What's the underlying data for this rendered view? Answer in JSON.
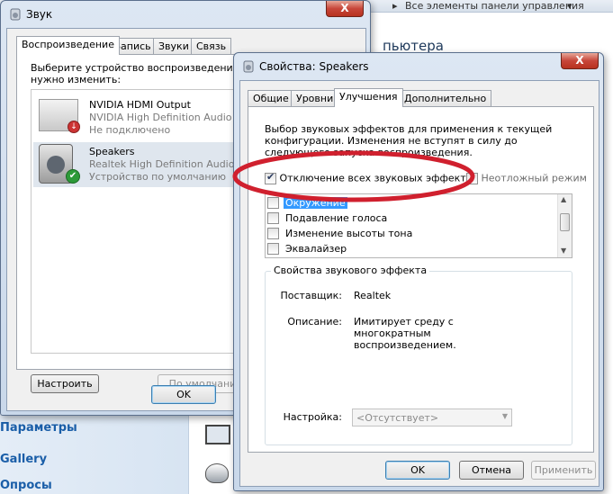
{
  "background": {
    "breadcrumb": "Все элементы панели управления",
    "heading": "пьютера",
    "sidebar_links": [
      "Параметры",
      "Gallery",
      "Опросы"
    ]
  },
  "sound_dialog": {
    "title": "Звук",
    "tabs": [
      "Воспроизведение",
      "Запись",
      "Звуки",
      "Связь"
    ],
    "instruction": "Выберите устройство воспроизведения, п",
    "instruction2": "нужно изменить:",
    "devices": [
      {
        "name": "NVIDIA HDMI Output",
        "driver": "NVIDIA High Definition Audio",
        "status": "Не подключено"
      },
      {
        "name": "Speakers",
        "driver": "Realtek High Definition Audio",
        "status": "Устройство по умолчанию"
      }
    ],
    "configure_label": "Настроить",
    "default_label": "По умолчани",
    "ok_label": "OK",
    "close_label": "X"
  },
  "props_dialog": {
    "title": "Свойства: Speakers",
    "close_label": "X",
    "tabs": [
      "Общие",
      "Уровни",
      "Улучшения",
      "Дополнительно"
    ],
    "description": "Выбор звуковых эффектов для применения к текущей конфигурации. Изменения не вступят в силу до следующего запуска воспроизведения.",
    "disable_all_label": "Отключение всех звуковых эффектов",
    "immediate_label": "Неотложный режим",
    "effects": [
      "Окружение",
      "Подавление голоса",
      "Изменение высоты тона",
      "Эквалайзер"
    ],
    "effect_props_title": "Свойства звукового эффекта",
    "provider_label": "Поставщик:",
    "provider_value": "Realtek",
    "description_label": "Описание:",
    "description_value": "Имитирует среду с многократным воспроизведением.",
    "settings_label": "Настройка:",
    "settings_value": "<Отсутствует>",
    "ok_label": "OK",
    "cancel_label": "Отмена",
    "apply_label": "Применить"
  },
  "colors": {
    "highlight_ellipse": "#d0202e",
    "selection": "#3399ff"
  }
}
